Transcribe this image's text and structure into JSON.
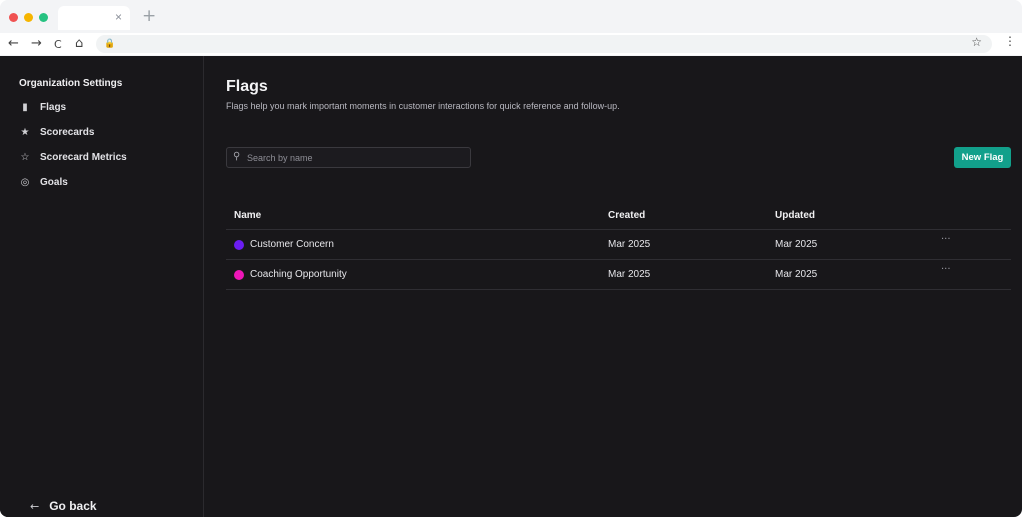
{
  "browser": {
    "tab_close": "×",
    "new_tab": "+",
    "nav": {
      "back": "←",
      "forward": "→",
      "reload": "C",
      "home": "⌂"
    },
    "lock": "🔒",
    "star": "☆",
    "menu": "⋮"
  },
  "sidebar": {
    "title": "Organization Settings",
    "items": [
      {
        "label": "Flags",
        "icon": "bookmark-icon",
        "glyph": "▮"
      },
      {
        "label": "Scorecards",
        "icon": "star-filled-icon",
        "glyph": "★"
      },
      {
        "label": "Scorecard Metrics",
        "icon": "star-outline-icon",
        "glyph": "☆"
      },
      {
        "label": "Goals",
        "icon": "target-icon",
        "glyph": "◎"
      }
    ],
    "go_back": {
      "label": "Go back",
      "glyph": "←"
    }
  },
  "main": {
    "title": "Flags",
    "subtitle": "Flags help you mark important moments in customer interactions for quick reference and follow-up.",
    "search": {
      "placeholder": "Search by name",
      "glyph": "⚲"
    },
    "new_button": "New Flag",
    "table": {
      "columns": [
        "Name",
        "Created",
        "Updated"
      ],
      "rows": [
        {
          "name": "Customer Concern",
          "color": "#6b1df2",
          "created": "Mar 2025",
          "updated": "Mar 2025",
          "menu": "···"
        },
        {
          "name": "Coaching Opportunity",
          "color": "#ee16b8",
          "created": "Mar 2025",
          "updated": "Mar 2025",
          "menu": "···"
        }
      ]
    }
  },
  "colors": {
    "background": "#18171a",
    "accent": "#12a08b"
  }
}
